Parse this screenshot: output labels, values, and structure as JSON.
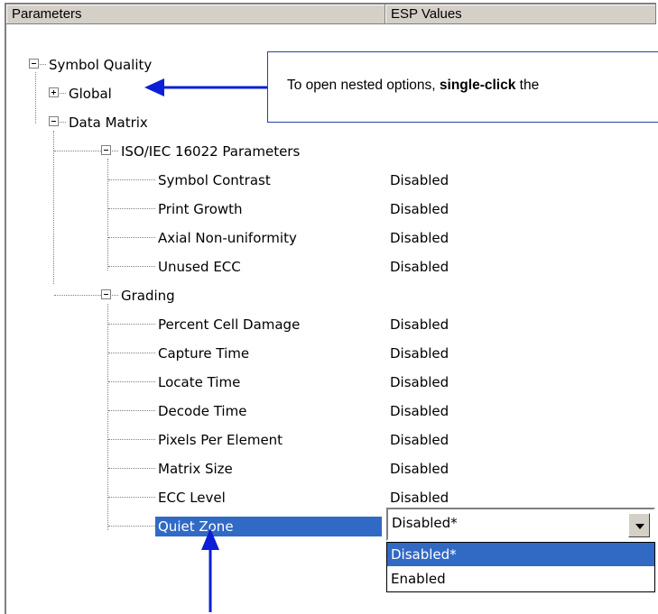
{
  "columns": {
    "parameters": "Parameters",
    "values": "ESP Values"
  },
  "tree": {
    "symbol_quality": "Symbol Quality",
    "global": "Global",
    "data_matrix": "Data Matrix",
    "iso": "ISO/IEC 16022 Parameters",
    "iso_items": [
      {
        "label": "Symbol Contrast",
        "value": "Disabled"
      },
      {
        "label": "Print Growth",
        "value": "Disabled"
      },
      {
        "label": "Axial Non-uniformity",
        "value": "Disabled"
      },
      {
        "label": "Unused ECC",
        "value": "Disabled"
      }
    ],
    "grading": "Grading",
    "grading_items": [
      {
        "label": "Percent Cell Damage",
        "value": "Disabled"
      },
      {
        "label": "Capture Time",
        "value": "Disabled"
      },
      {
        "label": "Locate Time",
        "value": "Disabled"
      },
      {
        "label": "Decode Time",
        "value": "Disabled"
      },
      {
        "label": "Pixels Per Element",
        "value": "Disabled"
      },
      {
        "label": "Matrix Size",
        "value": "Disabled"
      },
      {
        "label": "ECC Level",
        "value": "Disabled"
      },
      {
        "label": "Quiet Zone",
        "value": "Disabled*"
      }
    ]
  },
  "dropdown": {
    "current": "Disabled*",
    "options": [
      "Disabled*",
      "Enabled"
    ]
  },
  "callout": {
    "text_before": "To open nested options, ",
    "text_bold": "single-click",
    "text_after": " the"
  },
  "colors": {
    "selection": "#316ac5",
    "arrow": "#0a1fd6"
  }
}
